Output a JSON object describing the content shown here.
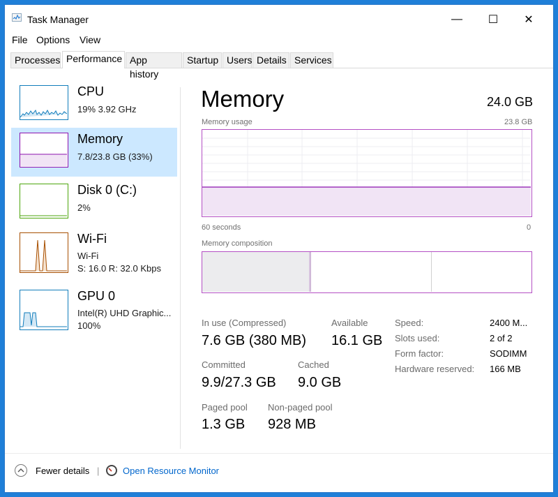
{
  "window": {
    "title": "Task Manager",
    "controls": [
      "—",
      "☐",
      "✕"
    ]
  },
  "menu": [
    "File",
    "Options",
    "View"
  ],
  "tabs": [
    "Processes",
    "Performance",
    "App history",
    "Startup",
    "Users",
    "Details",
    "Services"
  ],
  "active_tab": "Performance",
  "sidebar": {
    "items": [
      {
        "name": "CPU",
        "line1": "19% 3.92 GHz",
        "line2": "",
        "color": "#117dbb"
      },
      {
        "name": "Memory",
        "line1": "7.8/23.8 GB (33%)",
        "line2": "",
        "color": "#8b12ae"
      },
      {
        "name": "Disk 0 (C:)",
        "line1": "2%",
        "line2": "",
        "color": "#4da60c"
      },
      {
        "name": "Wi-Fi",
        "line1": "Wi-Fi",
        "line2": "S: 16.0 R: 32.0 Kbps",
        "color": "#a74f01"
      },
      {
        "name": "GPU 0",
        "line1": "Intel(R) UHD Graphic...",
        "line2": "100%",
        "color": "#117dbb"
      }
    ],
    "selected_index": 1
  },
  "main": {
    "heading": "Memory",
    "total": "24.0 GB",
    "usage_label": "Memory usage",
    "usage_max": "23.8 GB",
    "usage_level": 0.33,
    "axis_left": "60 seconds",
    "axis_right": "0",
    "composition_label": "Memory composition",
    "stats": {
      "in_use_label": "In use (Compressed)",
      "in_use_value": "7.6 GB (380 MB)",
      "available_label": "Available",
      "available_value": "16.1 GB",
      "committed_label": "Committed",
      "committed_value": "9.9/27.3 GB",
      "cached_label": "Cached",
      "cached_value": "9.0 GB",
      "paged_label": "Paged pool",
      "paged_value": "1.3 GB",
      "nonpaged_label": "Non-paged pool",
      "nonpaged_value": "928 MB"
    },
    "details": {
      "speed_label": "Speed:",
      "speed_value": "2400 M...",
      "slots_label": "Slots used:",
      "slots_value": "2 of 2",
      "form_label": "Form factor:",
      "form_value": "SODIMM",
      "reserved_label": "Hardware reserved:",
      "reserved_value": "166 MB"
    }
  },
  "footer": {
    "fewer_details": "Fewer details",
    "separator": "|",
    "resource_monitor": "Open Resource Monitor"
  }
}
